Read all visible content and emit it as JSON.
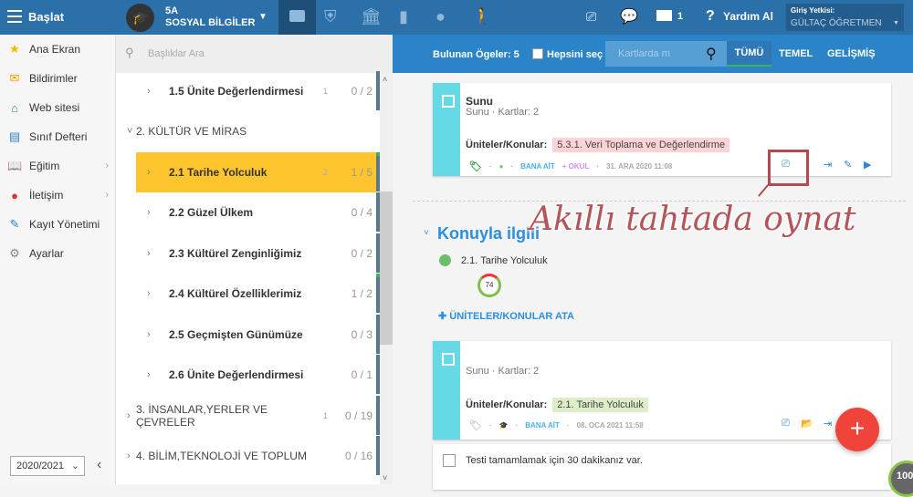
{
  "topbar": {
    "menu_label": "Başlat",
    "class_name": "5A",
    "course_name": "SOSYAL BİLGİLER",
    "message_count": "1",
    "help_label": "Yardım Al",
    "auth_label": "Giriş Yetkisi:",
    "user_name": "GÜLTAÇ ÖĞRETMEN"
  },
  "sidebar": {
    "items": [
      {
        "label": "Ana Ekran",
        "icon": "star-icon"
      },
      {
        "label": "Bildirimler",
        "icon": "mail-icon"
      },
      {
        "label": "Web sitesi",
        "icon": "home-icon"
      },
      {
        "label": "Sınıf Defteri",
        "icon": "notebook-icon"
      },
      {
        "label": "Eğitim",
        "icon": "book-icon"
      },
      {
        "label": "İletişim",
        "icon": "chat-icon"
      },
      {
        "label": "Kayıt Yönetimi",
        "icon": "pencil-icon"
      },
      {
        "label": "Ayarlar",
        "icon": "gear-icon"
      }
    ],
    "year": "2020/2021"
  },
  "topics": {
    "search_placeholder": "Başlıklar Ara",
    "rows": [
      {
        "label": "1.5  Ünite Değerlendirmesi",
        "count": "1",
        "progress": "0 / 2"
      },
      {
        "label": "2. KÜLTÜR VE MİRAS",
        "count": "",
        "progress": ""
      },
      {
        "label": "2.1  Tarihe Yolculuk",
        "count": "2",
        "progress": "1 / 5"
      },
      {
        "label": "2.2  Güzel Ülkem",
        "count": "",
        "progress": "0 / 4"
      },
      {
        "label": "2.3  Kültürel Zenginliğimiz",
        "count": "",
        "progress": "0 / 2"
      },
      {
        "label": "2.4  Kültürel Özelliklerimiz",
        "count": "",
        "progress": "1 / 2"
      },
      {
        "label": "2.5  Geçmişten Günümüze",
        "count": "",
        "progress": "0 / 3"
      },
      {
        "label": "2.6  Ünite Değerlendirmesi",
        "count": "",
        "progress": "0 / 1"
      },
      {
        "label": "3. İNSANLAR,YERLER VE ÇEVRELER",
        "count": "1",
        "progress": "0 / 19"
      },
      {
        "label": "4. BİLİM,TEKNOLOJİ VE TOPLUM",
        "count": "",
        "progress": "0 / 16"
      }
    ]
  },
  "content": {
    "found_label": "Bulunan Ögeler: 5",
    "select_all": "Hepsini seç",
    "card_search_placeholder": "Kartlarda m",
    "tabs": [
      "TÜMÜ",
      "TEMEL",
      "GELİŞMİŞ"
    ],
    "card1": {
      "title": "Sunu",
      "subtitle": "Sunu · Kartlar: 2",
      "topics_label": "Üniteler/Konular:",
      "topic": "5.3.1. Veri Toplama ve Değerlendirme",
      "owner": "BANA AİT",
      "school": "+ OKUL",
      "date": "31. ARA 2020 11:08"
    },
    "related_heading": "Konuyla ilgili",
    "related_topic": "2.1. Tarihe Yolculuk",
    "score": "74",
    "assign_label": "ÜNİTELER/KONULAR ATA",
    "card2": {
      "subtitle": "Sunu · Kartlar: 2",
      "topics_label": "Üniteler/Konular:",
      "topic": "2.1. Tarihe Yolculuk",
      "owner": "BANA AİT",
      "date": "08. OCA 2021 11:58"
    },
    "card3": {
      "text": "Testi tamamlamak için 30 dakikanız var."
    },
    "annotation": "Akıllı tahtada oynat",
    "corner_badge": "100"
  }
}
